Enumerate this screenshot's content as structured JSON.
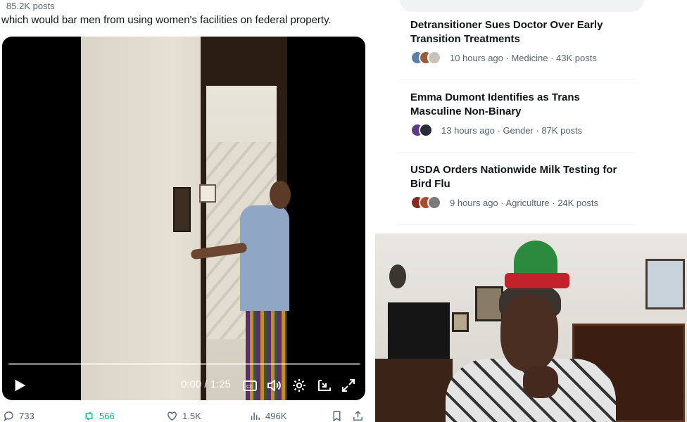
{
  "tweet": {
    "post_count": "85.2K posts",
    "text": "which would bar men from using women's facilities on federal property.",
    "video": {
      "time": "0:00 / 1:25",
      "progress_fraction": 0.0
    },
    "actions": {
      "replies": "733",
      "retweets": "566",
      "likes": "1.5K",
      "views": "496K"
    },
    "colors": {
      "retweet_green": "#00ba7c",
      "muted": "#536471"
    }
  },
  "trending": {
    "items": [
      {
        "title": "Detransitioner Sues Doctor Over Early Transition Treatments",
        "meta": "10 hours ago · Medicine · 43K posts",
        "avatars": [
          "#5b7fa6",
          "#9a5b3a",
          "#c9c2b8"
        ]
      },
      {
        "title": "Emma Dumont Identifies as Trans Masculine Non-Binary",
        "meta": "13 hours ago · Gender · 87K posts",
        "avatars": [
          "#5b3a8a",
          "#2a2a3a"
        ]
      },
      {
        "title": "USDA Orders Nationwide Milk Testing for Bird Flu",
        "meta": "9 hours ago · Agriculture · 24K posts",
        "avatars": [
          "#8a2a1e",
          "#b04a2a",
          "#7a7a7a"
        ]
      }
    ]
  },
  "webcam": {
    "icons": [
      "elf-hat"
    ]
  }
}
